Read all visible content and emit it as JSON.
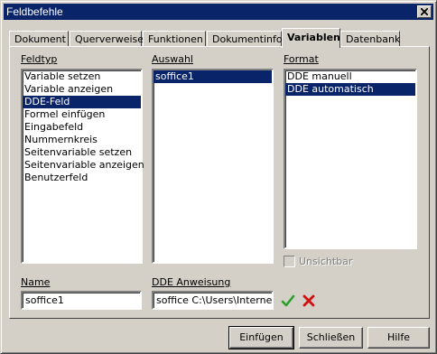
{
  "window": {
    "title": "Feldbefehle"
  },
  "tabs": [
    {
      "label": "Dokument"
    },
    {
      "label": "Querverweise"
    },
    {
      "label": "Funktionen"
    },
    {
      "label": "Dokumentinfo"
    },
    {
      "label": "Variablen",
      "active": true
    },
    {
      "label": "Datenbank"
    }
  ],
  "feldtyp": {
    "label": "Feldtyp",
    "items": [
      "Variable setzen",
      "Variable anzeigen",
      "DDE-Feld",
      "Formel einfügen",
      "Eingabefeld",
      "Nummernkreis",
      "Seitenvariable setzen",
      "Seitenvariable anzeigen",
      "Benutzerfeld"
    ],
    "selected": "DDE-Feld"
  },
  "auswahl": {
    "label": "Auswahl",
    "items": [
      "soffice1"
    ],
    "selected": "soffice1"
  },
  "format": {
    "label": "Format",
    "items": [
      "DDE manuell",
      "DDE automatisch"
    ],
    "selected": "DDE automatisch"
  },
  "unsichtbar": {
    "label": "Unsichtbar",
    "checked": false,
    "enabled": false
  },
  "name": {
    "label": "Name",
    "value": "soffice1"
  },
  "dde": {
    "label": "DDE Anweisung",
    "value": "soffice C:\\Users\\Internet\\D"
  },
  "actions": {
    "apply_icon": "check-icon",
    "delete_icon": "delete-icon"
  },
  "buttons": {
    "insert": "Einfügen",
    "close": "Schließen",
    "help": "Hilfe"
  },
  "colors": {
    "selection": "#0a246a",
    "titlebar": "#0a246a",
    "face": "#d4d0c8",
    "apply": "#2aa02a",
    "delete": "#d01010"
  }
}
